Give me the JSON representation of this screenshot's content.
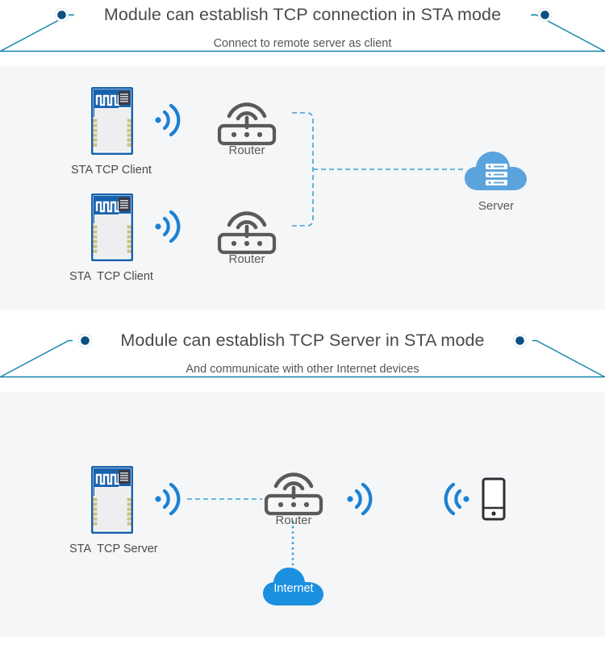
{
  "page": {
    "background": "#ffffff",
    "panel_background": "#f5f6f7",
    "accent_teal": "#1186a8",
    "accent_navy": "#0d4f82",
    "accent_blue": "#1b81d4",
    "cloud_blue": "#5ba3dd",
    "internet_blue": "#1b90e0",
    "device_gray": "#5a5a5a",
    "dash_blue": "#3e9fd6"
  },
  "sections": [
    {
      "id": "sta-tcp-client",
      "title": "Module can establish TCP connection in STA mode",
      "subtitle": "Connect to remote server as client",
      "nodes": {
        "module_1_label": "STA TCP Client",
        "module_2_label": "STA  TCP Client",
        "router_1_label": "Router",
        "router_2_label": "Router",
        "server_label": "Server"
      }
    },
    {
      "id": "sta-tcp-server",
      "title": "Module can establish TCP Server in STA mode",
      "subtitle": "And communicate with other Internet devices",
      "nodes": {
        "module_label": "STA  TCP Server",
        "router_label": "Router",
        "internet_label": "Internet",
        "phone_label": ""
      }
    }
  ],
  "icons": {
    "module": "wifi-module-icon",
    "router": "router-icon",
    "server": "server-cloud-icon",
    "internet": "internet-cloud-icon",
    "phone": "smartphone-icon",
    "signal": "wifi-signal-icon",
    "bullet": "bullet-dot-icon"
  }
}
